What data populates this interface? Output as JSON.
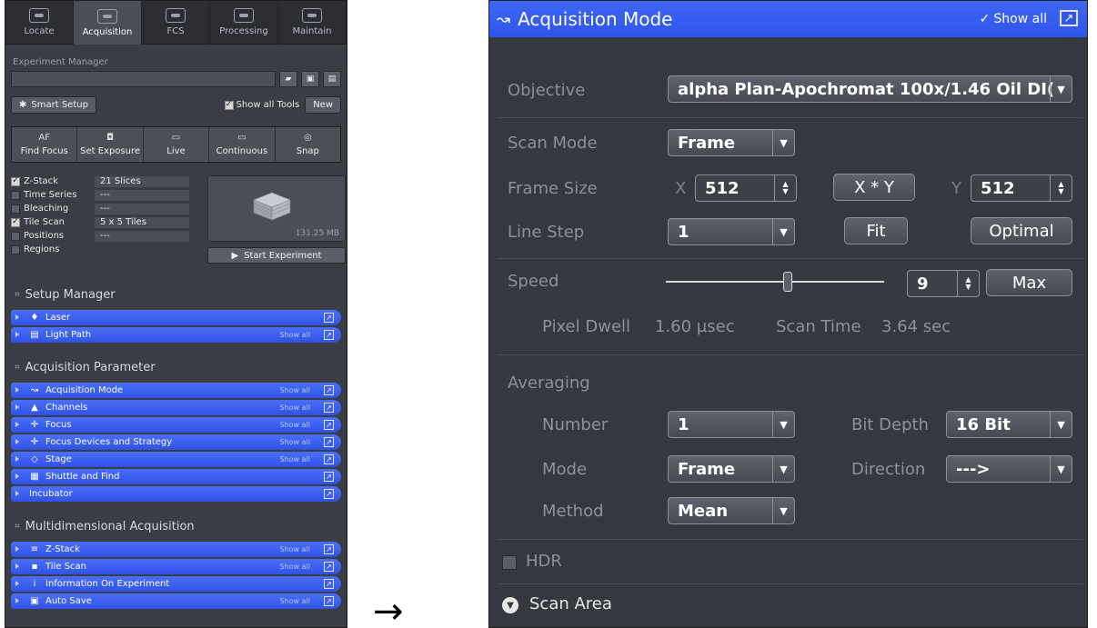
{
  "left": {
    "tabs": [
      {
        "label": "Locate",
        "icon": "locate-icon"
      },
      {
        "label": "Acquisition",
        "icon": "acquisition-icon"
      },
      {
        "label": "FCS",
        "icon": "fcs-icon"
      },
      {
        "label": "Processing",
        "icon": "processing-icon"
      },
      {
        "label": "Maintain",
        "icon": "maintain-icon"
      }
    ],
    "experiment_manager_label": "Experiment Manager",
    "smart_setup_label": "Smart Setup",
    "show_all_tools_label": "Show all Tools",
    "new_label": "New",
    "acq_buttons": [
      {
        "label": "Find Focus",
        "icon_text": "AF"
      },
      {
        "label": "Set Exposure",
        "icon_text": "◘"
      },
      {
        "label": "Live",
        "icon_text": "▭"
      },
      {
        "label": "Continuous",
        "icon_text": "▭"
      },
      {
        "label": "Snap",
        "icon_text": "◎"
      }
    ],
    "dims": [
      {
        "label": "Z-Stack",
        "value": "21 Slices",
        "checked": true
      },
      {
        "label": "Time Series",
        "value": "---",
        "checked": false
      },
      {
        "label": "Bleaching",
        "value": "---",
        "checked": false
      },
      {
        "label": "Tile Scan",
        "value": "5 x 5 Tiles",
        "checked": true
      },
      {
        "label": "Positions",
        "value": "---",
        "checked": false
      },
      {
        "label": "Regions",
        "value": "",
        "checked": false
      }
    ],
    "preview_size": "131.25 MB",
    "start_experiment_label": "Start Experiment",
    "setup_manager_label": "Setup Manager",
    "setup_bars": [
      {
        "label": "Laser",
        "show_all": "",
        "icon": "laser-icon"
      },
      {
        "label": "Light Path",
        "show_all": "Show all",
        "icon": "light-path-icon"
      }
    ],
    "acq_param_label": "Acquisition Parameter",
    "acq_bars": [
      {
        "label": "Acquisition Mode",
        "show_all": "Show all",
        "icon": "acquisition-mode-icon"
      },
      {
        "label": "Channels",
        "show_all": "Show all",
        "icon": "channels-icon"
      },
      {
        "label": "Focus",
        "show_all": "Show all",
        "icon": "focus-icon"
      },
      {
        "label": "Focus Devices and Strategy",
        "show_all": "Show all",
        "icon": "focus-devices-icon"
      },
      {
        "label": "Stage",
        "show_all": "Show all",
        "icon": "stage-icon"
      },
      {
        "label": "Shuttle and Find",
        "show_all": "",
        "icon": "shuttle-icon"
      },
      {
        "label": "Incubator",
        "show_all": "",
        "icon": ""
      }
    ],
    "multidim_label": "Multidimensional Acquisition",
    "multi_bars": [
      {
        "label": "Z-Stack",
        "show_all": "Show all",
        "icon": "z-stack-icon"
      },
      {
        "label": "Tile Scan",
        "show_all": "Show all",
        "icon": "tile-scan-icon"
      },
      {
        "label": "Information On Experiment",
        "show_all": "",
        "icon": "info-icon"
      },
      {
        "label": "Auto Save",
        "show_all": "Show all",
        "icon": "save-icon"
      }
    ]
  },
  "arrow": "→",
  "right": {
    "title": "Acquisition Mode",
    "show_all": "Show all",
    "objective_label": "Objective",
    "objective_value": "alpha Plan-Apochromat 100x/1.46 Oil DI(",
    "scan_mode_label": "Scan Mode",
    "scan_mode_value": "Frame",
    "frame_size_label": "Frame Size",
    "x_label": "X",
    "x_value": "512",
    "xy_label": "X * Y",
    "y_label": "Y",
    "y_value": "512",
    "line_step_label": "Line Step",
    "line_step_value": "1",
    "fit_label": "Fit",
    "optimal_label": "Optimal",
    "speed_label": "Speed",
    "speed_value": "9",
    "speed_level": 0.56,
    "max_label": "Max",
    "pixel_dwell_label": "Pixel Dwell",
    "pixel_dwell_value": "1.60 µsec",
    "scan_time_label": "Scan Time",
    "scan_time_value": "3.64 sec",
    "averaging_label": "Averaging",
    "number_label": "Number",
    "number_value": "1",
    "bit_depth_label": "Bit Depth",
    "bit_depth_value": "16 Bit",
    "mode_label": "Mode",
    "mode_value": "Frame",
    "direction_label": "Direction",
    "direction_value": "--->",
    "method_label": "Method",
    "method_value": "Mean",
    "hdr_label": "HDR",
    "scan_area_label": "Scan Area"
  },
  "colors": {
    "header_blue": "#3f67f5",
    "panel_bg": "#35383e"
  }
}
